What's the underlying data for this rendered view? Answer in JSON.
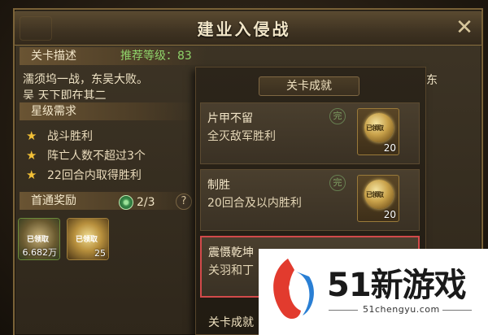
{
  "window": {
    "title": "建业入侵战",
    "close_glyph": "✕"
  },
  "stage": {
    "header_label": "关卡描述",
    "recommend_label": "推荐等级：83",
    "description": "濡须坞一战，东吴大败。",
    "desc_fragment_right": "东",
    "desc_line2": "吴 天下即在其二"
  },
  "stars": {
    "header_label": "星级需求",
    "items": [
      {
        "text": "战斗胜利"
      },
      {
        "text": "阵亡人数不超过3个"
      },
      {
        "text": "22回合内取得胜利"
      }
    ]
  },
  "first_reward": {
    "header_label": "首通奖励",
    "progress": "2/3",
    "help_glyph": "?",
    "items": [
      {
        "icon": "bronze-coin-icon",
        "count": "6.682万",
        "label": "已领取"
      },
      {
        "icon": "gold-coin-icon",
        "count": "25",
        "label": "已领取"
      }
    ]
  },
  "achievements": {
    "title": "关卡成就",
    "items": [
      {
        "name": "片甲不留",
        "condition": "全灭敌军胜利",
        "status": "完",
        "reward_count": "20",
        "reward_label": "已领取"
      },
      {
        "name": "制胜",
        "condition": "20回合及以内胜利",
        "status": "完",
        "reward_count": "20",
        "reward_label": "已领取"
      },
      {
        "name": "震慑乾坤",
        "condition": "关羽和丁"
      }
    ],
    "bottom_label": "关卡成就"
  },
  "watermark": {
    "brand": "51新游戏",
    "url": "51chengyu.com"
  },
  "colors": {
    "accent_gold": "#f2c037",
    "recommend_green": "#8fd36a",
    "highlight_red": "#d24a4a"
  }
}
